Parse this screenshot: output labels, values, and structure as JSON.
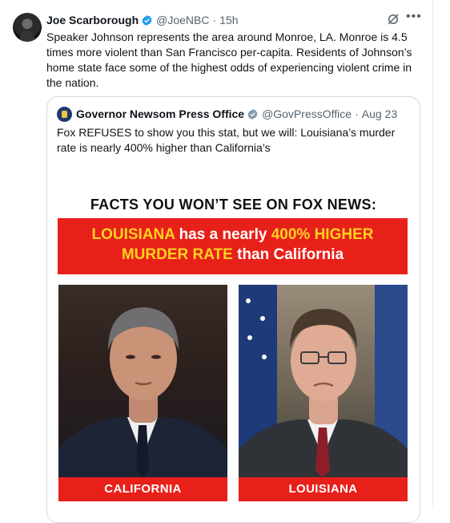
{
  "tweet": {
    "author_name": "Joe Scarborough",
    "handle": "@JoeNBC",
    "separator": "·",
    "time": "15h",
    "text": "Speaker Johnson represents the area around Monroe, LA. Monroe is 4.5 times more violent than San Francisco per-capita. Residents of Johnson’s home state face some of the highest odds of experiencing violent crime in the nation."
  },
  "quote": {
    "author_name": "Governor Newsom Press Office",
    "handle": "@GovPressOffice",
    "separator": "·",
    "time": "Aug 23",
    "text": "Fox REFUSES to show you this stat, but we will: Louisiana’s murder rate is nearly 400% higher than California’s"
  },
  "graphic": {
    "headline": "FACTS YOU WON’T SEE ON FOX NEWS:",
    "banner_line1_a": "LOUISIANA",
    "banner_line1_b": " has a nearly ",
    "banner_line1_c": "400% HIGHER",
    "banner_line2_a": "MURDER RATE",
    "banner_line2_b": " than California",
    "left_label": "CALIFORNIA",
    "right_label": "LOUISIANA"
  },
  "icons": {
    "verified": "verified-badge-icon",
    "grok": "grok-icon",
    "more": "more-icon"
  },
  "colors": {
    "accent": "#1d9bf0",
    "banner_red": "#e8201a",
    "highlight_yellow": "#ffd21e"
  }
}
